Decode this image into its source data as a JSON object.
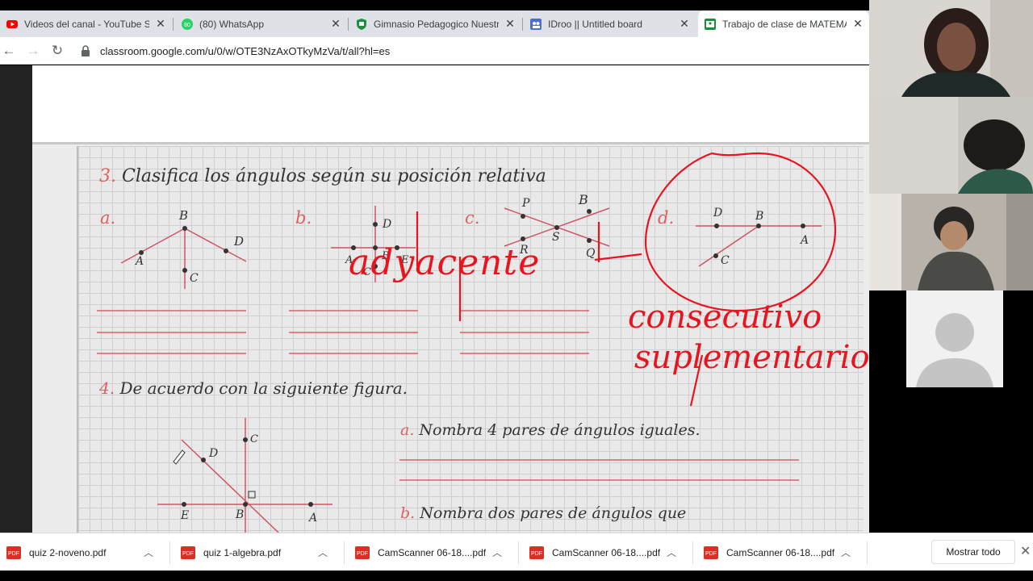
{
  "tabs": [
    {
      "title": "Videos del canal - YouTube Stu",
      "icon": "youtube-icon",
      "color": "#ff0000"
    },
    {
      "title": "(80) WhatsApp",
      "icon": "whatsapp-icon",
      "color": "#25d366"
    },
    {
      "title": "Gimnasio Pedagogico Nuestra",
      "icon": "shield-icon",
      "color": "#1e8e3e"
    },
    {
      "title": "IDroo || Untitled board",
      "icon": "idroo-icon",
      "color": "#4a6fd0"
    },
    {
      "title": "Trabajo de clase de MATEMAT",
      "icon": "classroom-icon",
      "color": "#1e8e3e"
    }
  ],
  "address": {
    "url": "classroom.google.com/u/0/w/OTE3NzAxOTkyMzVa/t/all?hl=es"
  },
  "worksheet": {
    "q3_number": "3.",
    "q3_text": "Clasifica los ángulos según su posición relativa",
    "labels_a": [
      "a.",
      "B",
      "D",
      "A",
      "C"
    ],
    "labels_b": [
      "b.",
      "D",
      "A",
      "B",
      "E",
      "C"
    ],
    "labels_c": [
      "c.",
      "P",
      "B",
      "R",
      "S",
      "Q"
    ],
    "labels_d": [
      "d.",
      "D",
      "B",
      "A",
      "C"
    ],
    "q4_number": "4.",
    "q4_text": "De acuerdo con la siguiente figura.",
    "q4_labels": [
      "C",
      "D",
      "E",
      "B",
      "A"
    ],
    "qa_letter": "a.",
    "qa_text": "Nombra 4 pares de ángulos iguales.",
    "qb_letter": "b.",
    "qb_text": "Nombra dos pares de ángulos que"
  },
  "annotations": {
    "word1": "adyacente",
    "word2": "consecutivo",
    "word3": "suplementario",
    "color": "#e8141e"
  },
  "participants": [
    {
      "label": "participant-1"
    },
    {
      "label": "participant-2"
    },
    {
      "label": "participant-3"
    },
    {
      "label": "participant-4"
    }
  ],
  "downloads": {
    "items": [
      "quiz 2-noveno.pdf",
      "quiz 1-algebra.pdf",
      "CamScanner 06-18....pdf",
      "CamScanner 06-18....pdf",
      "CamScanner 06-18....pdf"
    ],
    "show_all": "Mostrar todo"
  }
}
